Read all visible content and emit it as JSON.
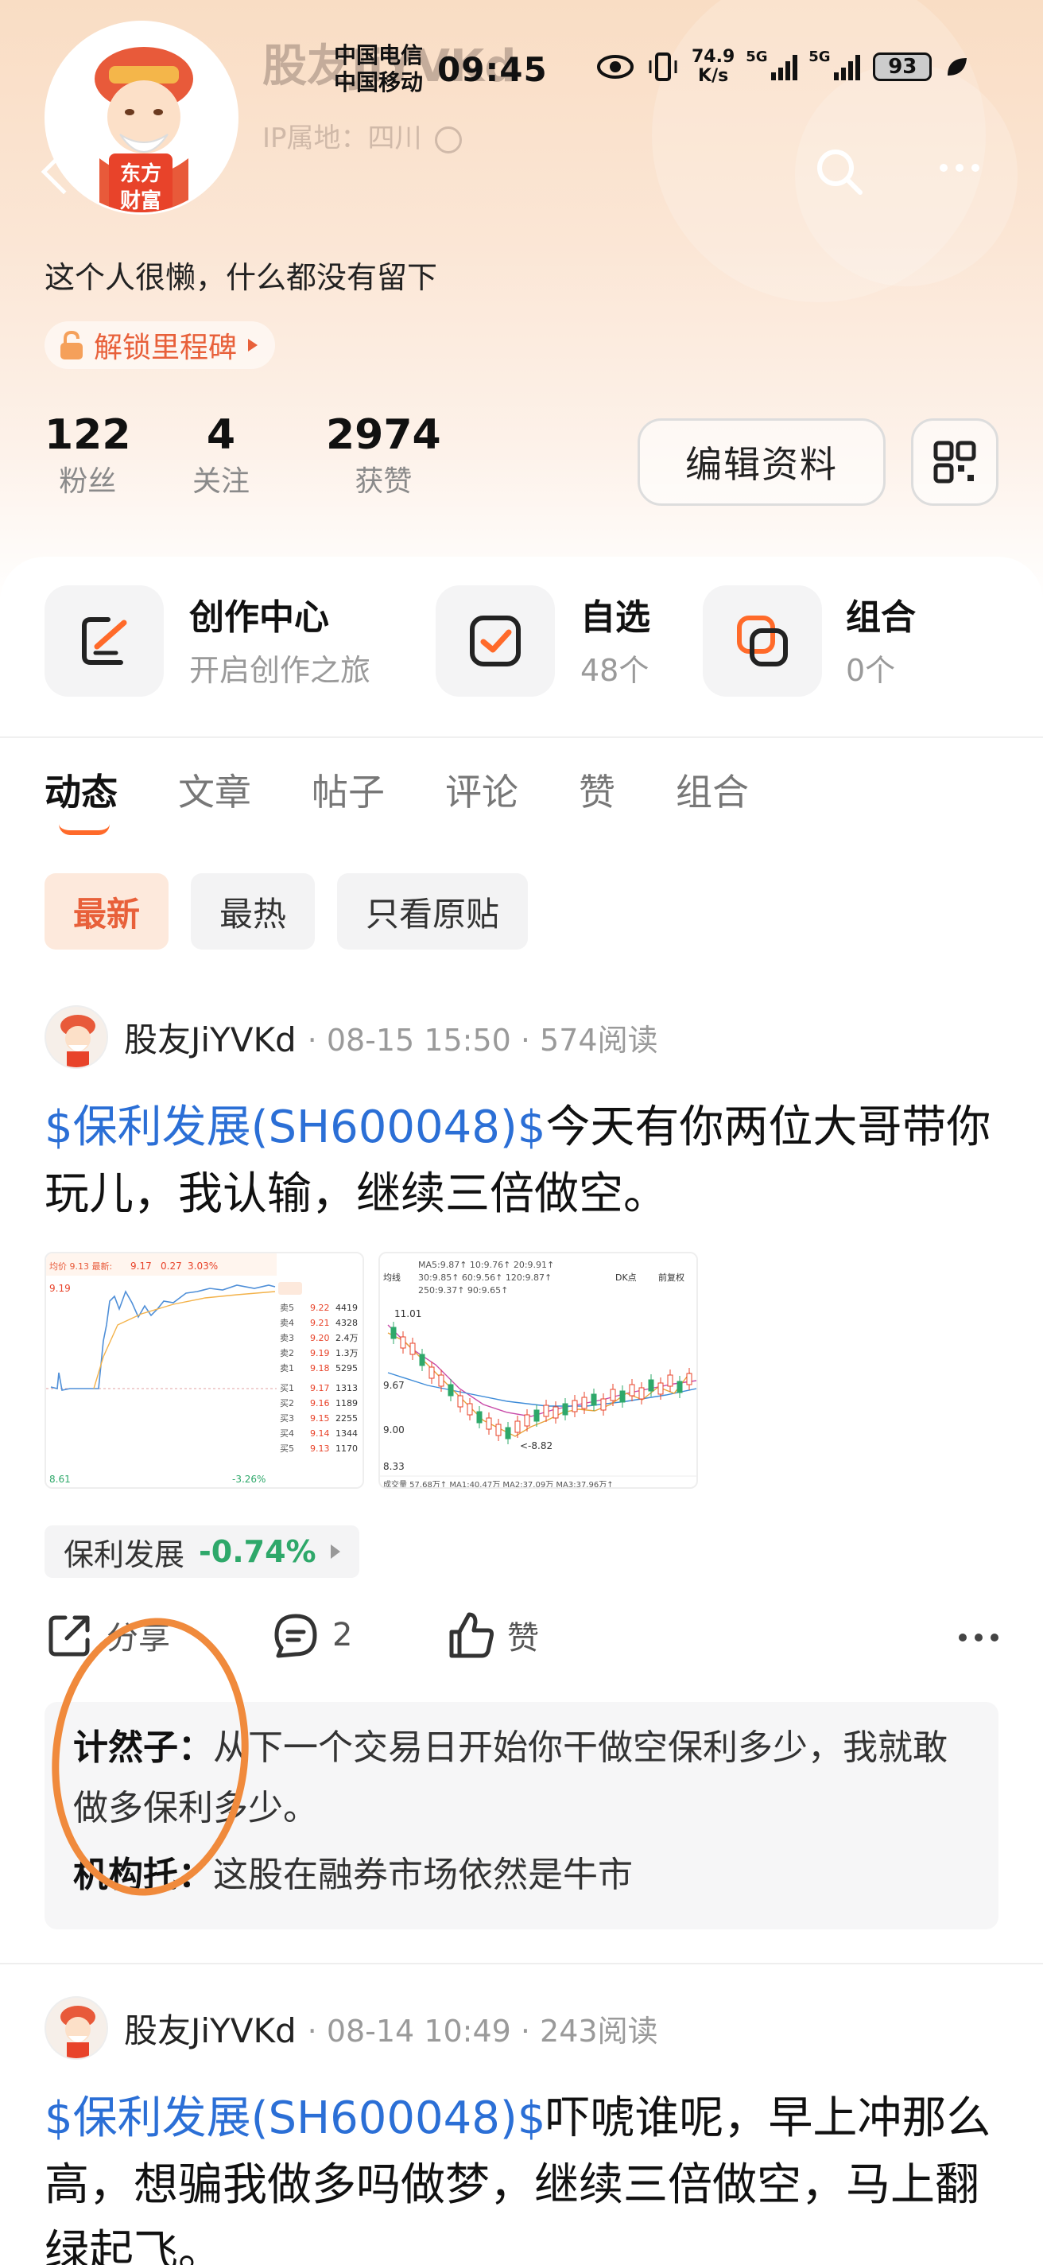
{
  "status_bar": {
    "carrier1": "中国电信",
    "carrier2": "中国移动",
    "time": "09:45",
    "net_speed_value": "74.9",
    "net_speed_unit": "K/s",
    "signal1": "5G",
    "signal2": "5G",
    "battery": "93"
  },
  "profile": {
    "username": "股友JiYVKd",
    "ip": "IP属地：四川",
    "avatar_logo_line1": "东方",
    "avatar_logo_line2": "财富",
    "bio": "这个人很懒，什么都没有留下",
    "milestone": "解锁里程碑",
    "stats": [
      {
        "value": "122",
        "label": "粉丝"
      },
      {
        "value": "4",
        "label": "关注"
      },
      {
        "value": "2974",
        "label": "获赞"
      }
    ],
    "edit_label": "编辑资料"
  },
  "quick": [
    {
      "title": "创作中心",
      "sub": "开启创作之旅"
    },
    {
      "title": "自选",
      "sub": "48个"
    },
    {
      "title": "组合",
      "sub": "0个"
    }
  ],
  "tabs": [
    "动态",
    "文章",
    "帖子",
    "评论",
    "赞",
    "组合"
  ],
  "filters": [
    "最新",
    "最热",
    "只看原贴"
  ],
  "posts": [
    {
      "author": "股友JiYVKd",
      "meta": "· 08-15 15:50 · 574阅读",
      "stock": "$保利发展(SH600048)$",
      "text": "今天有你两位大哥带你玩儿，我认输，继续三倍做空。",
      "tag_name": "保利发展",
      "tag_change": "-0.74%",
      "share": "分享",
      "comments": "2",
      "like": "赞",
      "replies": [
        {
          "user": "计然子",
          "text": "从下一个交易日开始你干做空保利多少，我就敢做多保利多少。"
        },
        {
          "user": "机构托",
          "text": "这股在融券市场依然是牛市"
        }
      ]
    },
    {
      "author": "股友JiYVKd",
      "meta": "· 08-14 10:49 · 243阅读",
      "stock": "$保利发展(SH600048)$",
      "text": "吓唬谁呢，早上冲那么高，想骗我做多吗做梦，继续三倍做空，马上翻绿起飞。"
    }
  ],
  "thumb1": {
    "price_labels": [
      "9.19",
      "8.61"
    ],
    "change_labels": [
      "9.17",
      "0.27",
      "3.03%"
    ],
    "low_change": "-3.26%",
    "book": [
      [
        "卖5",
        "9.22",
        "4419"
      ],
      [
        "卖4",
        "9.21",
        "4328"
      ],
      [
        "卖3",
        "9.20",
        "2.4万"
      ],
      [
        "卖2",
        "9.19",
        "1.3万"
      ],
      [
        "卖1",
        "9.18",
        "5295"
      ],
      [
        "买1",
        "9.17",
        "1313"
      ],
      [
        "买2",
        "9.16",
        "1189"
      ],
      [
        "买3",
        "9.15",
        "2255"
      ],
      [
        "买4",
        "9.14",
        "1344"
      ],
      [
        "买5",
        "9.13",
        "1170"
      ]
    ]
  },
  "thumb2": {
    "ma_line1": "MA5:9.87↑ 10:9.76↑ 20:9.91↑",
    "ma_line2": "30:9.85↑ 60:9.56↑ 120:9.87↑",
    "ma_line3": "250:9.37↑ 90:9.65↑",
    "price_labels": [
      "11.01",
      "9.67",
      "9.00",
      "8.33"
    ],
    "low_label": "<-8.82",
    "volume_line": "成交量 57.68万↑ MA1:40.47万 MA2:37.09万 MA3:37.96万↑",
    "buttons": [
      "均线",
      "DK点",
      "前复权"
    ]
  },
  "colors": {
    "accent": "#e8603a",
    "link": "#2b6fd6",
    "down": "#2ea86a",
    "annotation": "#f08a3c"
  }
}
